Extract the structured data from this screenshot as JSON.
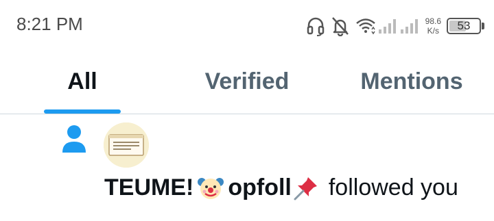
{
  "status_bar": {
    "time": "8:21 PM",
    "speed_value": "98.6",
    "speed_unit": "K/s",
    "battery_level": "53",
    "icons": [
      "headset-icon",
      "bell-muted-icon",
      "wifi-icon",
      "signal-icon",
      "signal-icon",
      "battery-icon"
    ]
  },
  "tabs": [
    {
      "label": "All",
      "active": true
    },
    {
      "label": "Verified",
      "active": false
    },
    {
      "label": "Mentions",
      "active": false
    }
  ],
  "colors": {
    "accent": "#1d9bf0",
    "text_primary": "#0f1419",
    "text_secondary": "#536471",
    "divider": "#cfd9de"
  },
  "notification": {
    "type_icon": "person-icon",
    "user_name": "TEUME!",
    "name_emoji": "clown-face-icon",
    "handle": "opfoll",
    "handle_emoji": "pushpin-icon",
    "action": "followed you"
  }
}
